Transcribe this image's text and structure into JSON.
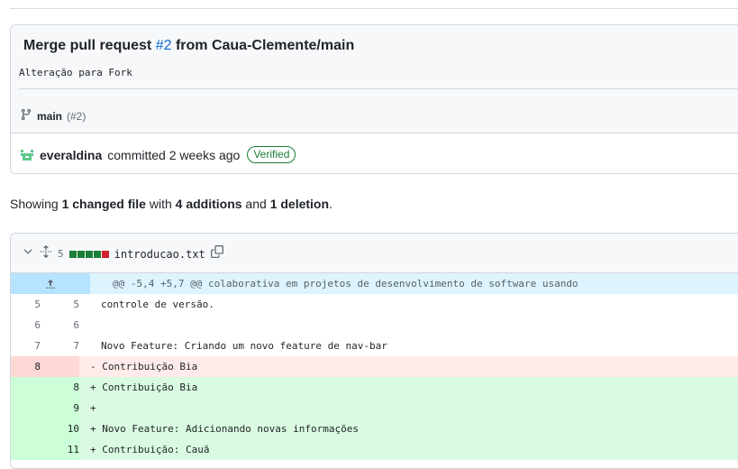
{
  "commit": {
    "title_prefix": "Merge pull request ",
    "pr_link": "#2",
    "title_suffix": " from Caua-Clemente/main",
    "description": "Alteração para Fork",
    "branch": "main",
    "branch_pr": "(#2)",
    "author": "everaldina",
    "committed_text": "committed 2 weeks ago",
    "verified_label": "Verified"
  },
  "summary": {
    "prefix": "Showing ",
    "files": "1 changed file",
    "with": " with ",
    "additions": "4 additions",
    "and": " and ",
    "deletions": "1 deletion",
    "end": "."
  },
  "file": {
    "change_count": "5",
    "name": "introducao.txt",
    "diffstat_colors": [
      "#1a7f37",
      "#1a7f37",
      "#1a7f37",
      "#1a7f37",
      "#cf222e"
    ],
    "hunk_header": "@@ -5,4 +5,7 @@ colaborativa em projetos de desenvolvimento de software usando",
    "lines": [
      {
        "type": "plain",
        "old": "5",
        "new": "5",
        "text": "controle de versão."
      },
      {
        "type": "plain",
        "old": "6",
        "new": "6",
        "text": ""
      },
      {
        "type": "plain",
        "old": "7",
        "new": "7",
        "text": "Novo Feature: Criando um novo feature de nav-bar"
      },
      {
        "type": "del",
        "old": "8",
        "new": "",
        "text": "- Contribuição Bia"
      },
      {
        "type": "add",
        "old": "",
        "new": "8",
        "text": "+ Contribuição Bia"
      },
      {
        "type": "add",
        "old": "",
        "new": "9",
        "text": "+"
      },
      {
        "type": "add",
        "old": "",
        "new": "10",
        "text": "+ Novo Feature: Adicionando novas informações"
      },
      {
        "type": "add",
        "old": "",
        "new": "11",
        "text": "+ Contribuição: Cauã"
      }
    ]
  }
}
